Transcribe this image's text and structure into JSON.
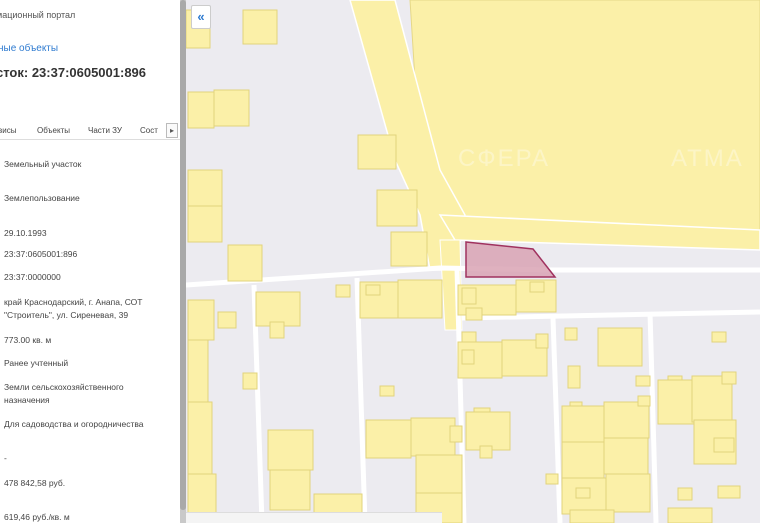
{
  "panel": {
    "portal_title": "мационный портал",
    "objects_link": "ные объекты",
    "parcel_heading": "сток: 23:37:0605001:896",
    "tabs": [
      {
        "label": "висы"
      },
      {
        "label": "Объекты"
      },
      {
        "label": "Части ЗУ"
      },
      {
        "label": "Сост"
      }
    ],
    "tab_next": "▸",
    "fields": [
      {
        "value": "Земельный участок"
      },
      {
        "value": "Землепользование"
      },
      {
        "value": "29.10.1993"
      },
      {
        "value": "23:37:0605001:896"
      },
      {
        "value": "23:37:0000000"
      },
      {
        "value": "край Краснодарский, г. Анапа, СОТ"
      },
      {
        "value": "\"Строитель\", ул. Сиреневая, 39"
      },
      {
        "value": "773.00 кв. м"
      },
      {
        "value": "Ранее учтенный"
      },
      {
        "value": "Земли сельскохозяйственного"
      },
      {
        "value": "назначения"
      },
      {
        "value": "Для садоводства и огородничества"
      },
      {
        "value": "-"
      },
      {
        "value": "478 842,58 руб."
      },
      {
        "value": "619,46 руб./кв. м"
      }
    ]
  },
  "map": {
    "collapse_icon": "«",
    "watermarks": [
      "СФЕРА",
      "АТМА"
    ],
    "colors": {
      "background": "#ecebf0",
      "parcel_fill": "#fbf0a8",
      "parcel_stroke": "#e2d37c",
      "road_edge": "#ffffff",
      "selected_fill": "#d9a3b4",
      "selected_stroke": "#a0325f",
      "accent": "#2f7bd0"
    }
  }
}
